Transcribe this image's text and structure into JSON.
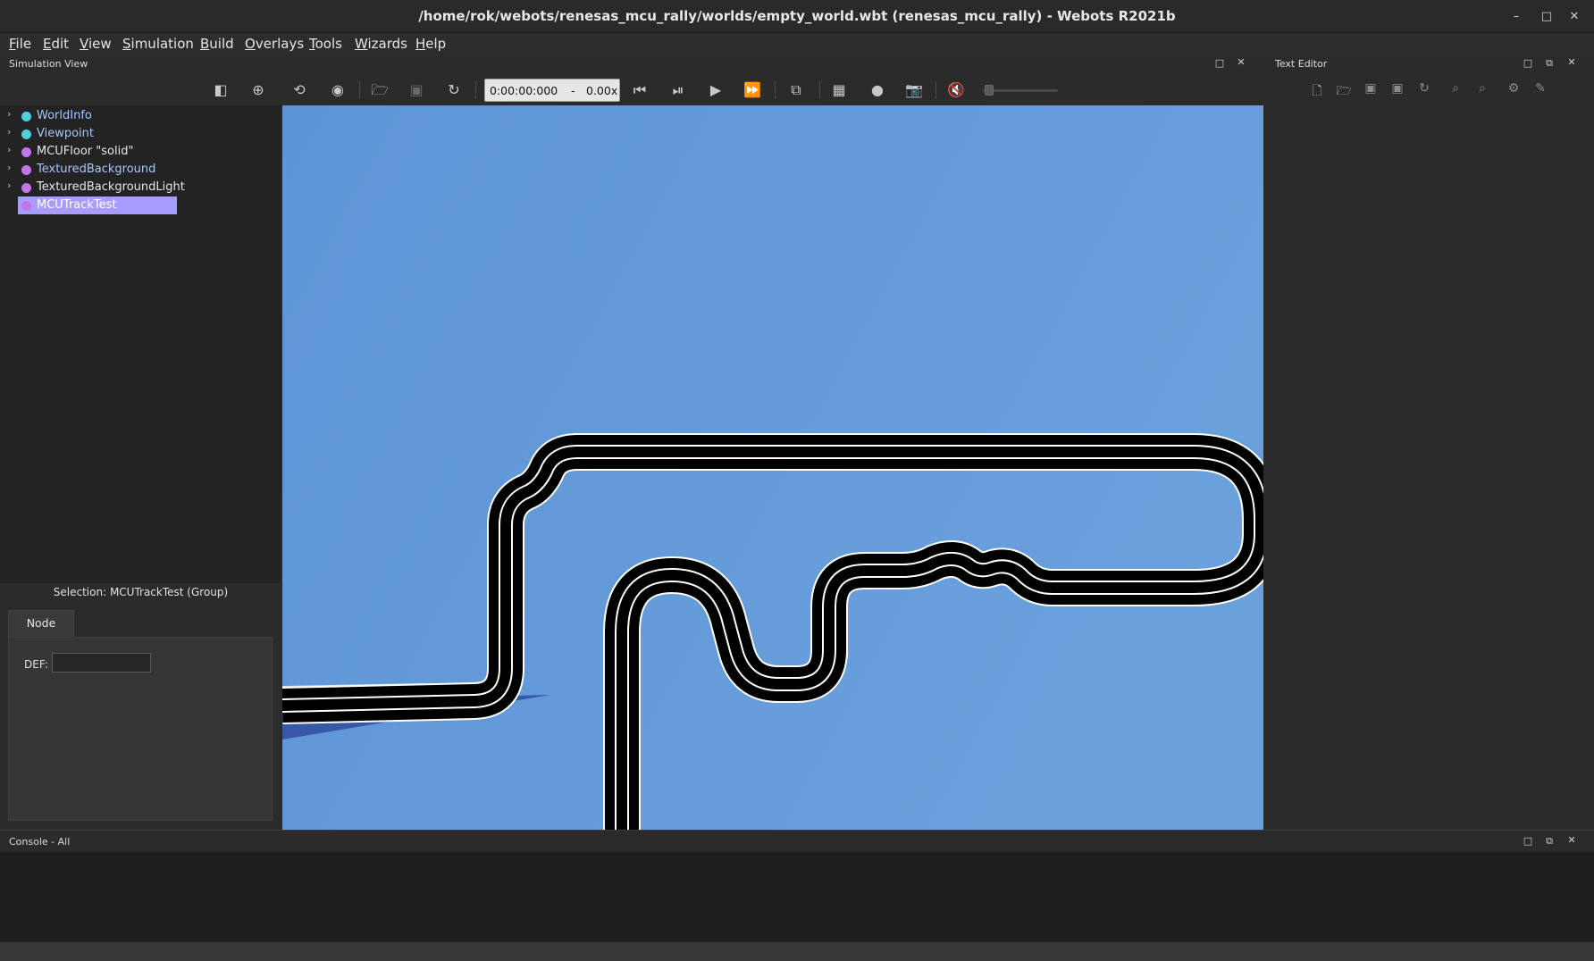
{
  "window": {
    "title": "/home/rok/webots/renesas_mcu_rally/worlds/empty_world.wbt (renesas_mcu_rally) - Webots R2021b",
    "controls": [
      "–",
      "□",
      "✕"
    ]
  },
  "menu": [
    {
      "mnemonic": "F",
      "rest": "ile"
    },
    {
      "mnemonic": "E",
      "rest": "dit"
    },
    {
      "mnemonic": "V",
      "rest": "iew"
    },
    {
      "mnemonic": "S",
      "rest": "imulation"
    },
    {
      "mnemonic": "B",
      "rest": "uild"
    },
    {
      "mnemonic": "O",
      "rest": "verlays"
    },
    {
      "mnemonic": "T",
      "rest": "ools"
    },
    {
      "mnemonic": "W",
      "rest": "izards"
    },
    {
      "mnemonic": "H",
      "rest": "elp"
    }
  ],
  "simulation_view": {
    "dock_title": "Simulation View",
    "time": "0:00:00:000",
    "separator": "-",
    "speed": "0.00x"
  },
  "scene_tree": {
    "items": [
      {
        "label": "WorldInfo",
        "color": "#4fd0d8",
        "text_color": "#a6c8ff",
        "expandable": true,
        "selected": false
      },
      {
        "label": "Viewpoint",
        "color": "#4fd0d8",
        "text_color": "#a6c8ff",
        "expandable": true,
        "selected": false
      },
      {
        "label": "MCUFloor \"solid\"",
        "color": "#c575e8",
        "text_color": "#e6e6e6",
        "expandable": true,
        "selected": false
      },
      {
        "label": "TexturedBackground",
        "color": "#c575e8",
        "text_color": "#a6c8ff",
        "expandable": true,
        "selected": false
      },
      {
        "label": "TexturedBackgroundLight",
        "color": "#c575e8",
        "text_color": "#e6e6e6",
        "expandable": true,
        "selected": false
      },
      {
        "label": "MCUTrackTest",
        "color": "#c575e8",
        "text_color": "#ffffff",
        "expandable": false,
        "selected": true
      }
    ]
  },
  "field_editor": {
    "selection": "Selection: MCUTrackTest (Group)",
    "tab": "Node",
    "def_label": "DEF:",
    "def_value": ""
  },
  "text_editor": {
    "dock_title": "Text Editor"
  },
  "console": {
    "dock_title": "Console - All"
  },
  "colors": {
    "sky": "#6199d8",
    "selection": "#a89cff",
    "track": "#000000"
  }
}
